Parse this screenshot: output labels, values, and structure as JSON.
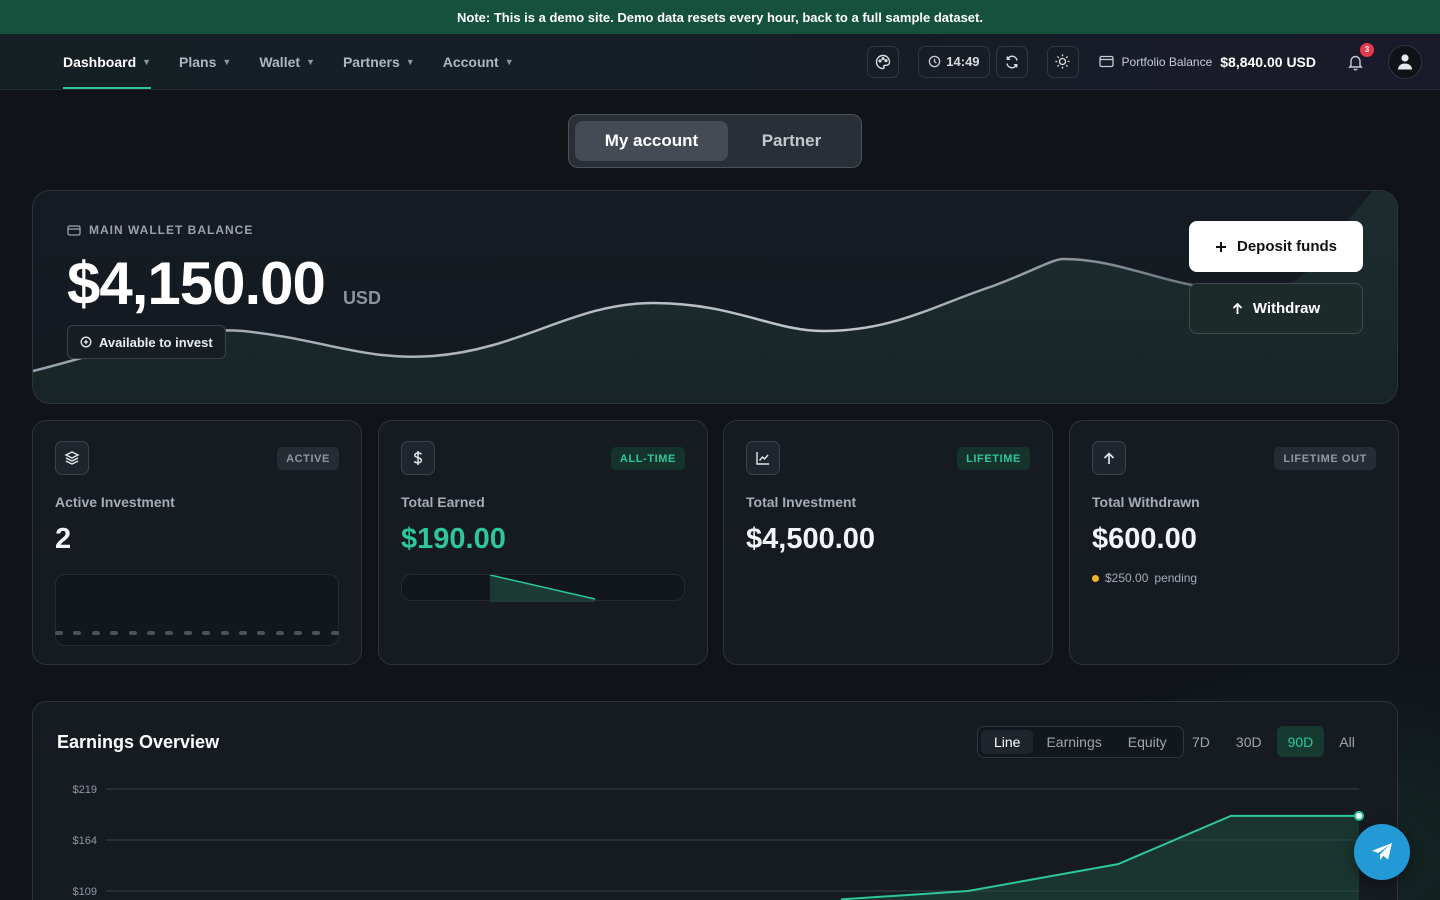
{
  "notice": "Note: This is a demo site. Demo data resets every hour, back to a full sample dataset.",
  "nav": {
    "items": [
      {
        "label": "Dashboard",
        "active": true
      },
      {
        "label": "Plans",
        "active": false
      },
      {
        "label": "Wallet",
        "active": false
      },
      {
        "label": "Partners",
        "active": false
      },
      {
        "label": "Account",
        "active": false
      }
    ]
  },
  "topbar": {
    "time": "14:49",
    "portfolio_label": "Portfolio Balance",
    "portfolio_value": "$8,840.00 USD",
    "notification_count": "3"
  },
  "switcher": {
    "options": [
      "My account",
      "Partner"
    ],
    "selected": "My account"
  },
  "hero": {
    "label": "MAIN WALLET BALANCE",
    "amount": "$4,150.00",
    "currency": "USD",
    "available_label": "Available to invest",
    "deposit_label": "Deposit funds",
    "withdraw_label": "Withdraw"
  },
  "cards": [
    {
      "icon": "layers-icon",
      "tag": "ACTIVE",
      "title": "Active Investment",
      "value": "2"
    },
    {
      "icon": "dollar-icon",
      "tag": "ALL-TIME",
      "title": "Total Earned",
      "value": "$190.00"
    },
    {
      "icon": "chart-line-icon",
      "tag": "LIFETIME",
      "title": "Total Investment",
      "value": "$4,500.00"
    },
    {
      "icon": "arrow-up-icon",
      "tag": "LIFETIME OUT",
      "title": "Total Withdrawn",
      "value": "$600.00",
      "pending_amount": "$250.00",
      "pending_label": "pending"
    }
  ],
  "earnings": {
    "title": "Earnings Overview",
    "modes": [
      "Line",
      "Earnings",
      "Equity"
    ],
    "mode_selected": "Line",
    "ranges": [
      "7D",
      "30D",
      "90D",
      "All"
    ],
    "range_selected": "90D"
  },
  "chart_data": {
    "type": "area",
    "y_ticks": [
      "$219",
      "$164",
      "$109"
    ],
    "ylim": [
      100,
      219
    ],
    "values": [
      100,
      109,
      138,
      190,
      190
    ],
    "grid": true,
    "title": "",
    "xlabel": "",
    "ylabel": ""
  },
  "colors": {
    "accent": "#2ec799",
    "notice_bg": "#15513c",
    "badge": "#e5384a",
    "pending_dot": "#f0b429",
    "fab": "#239ad6"
  }
}
